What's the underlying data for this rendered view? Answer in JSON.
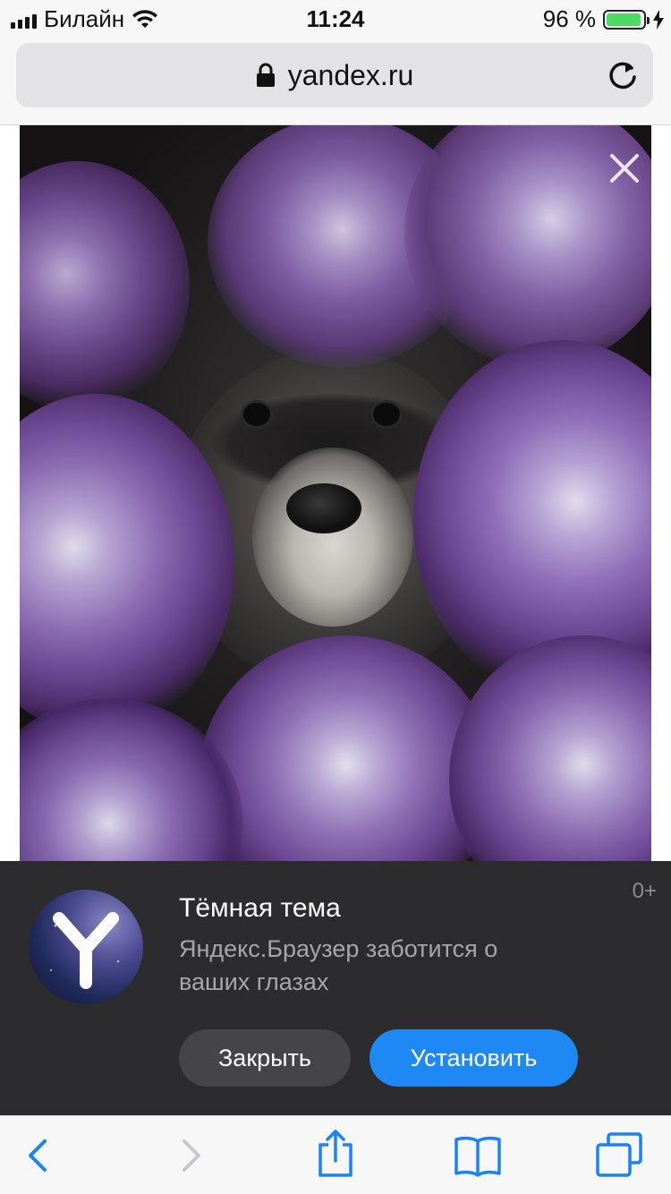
{
  "status_bar": {
    "carrier": "Билайн",
    "time": "11:24",
    "battery_text": "96 %",
    "battery_level_percent": 96,
    "battery_color": "#4cd964"
  },
  "address_bar": {
    "url": "yandex.ru",
    "icons": [
      "lock-icon",
      "reload-icon"
    ]
  },
  "content": {
    "image_description_icon": "photo",
    "close_icon": "close-icon"
  },
  "banner": {
    "app_icon": "yandex-browser-icon",
    "title": "Тёмная тема",
    "subtitle": "Яндекс.Браузер заботится о ваших глазах",
    "age_rating": "0+",
    "close_label": "Закрыть",
    "install_label": "Установить",
    "accent_color": "#1e89f5"
  },
  "toolbar": {
    "icons": [
      "back-icon",
      "forward-icon",
      "share-icon",
      "bookmarks-icon",
      "tabs-icon"
    ],
    "tint_color": "#1a82f7"
  }
}
